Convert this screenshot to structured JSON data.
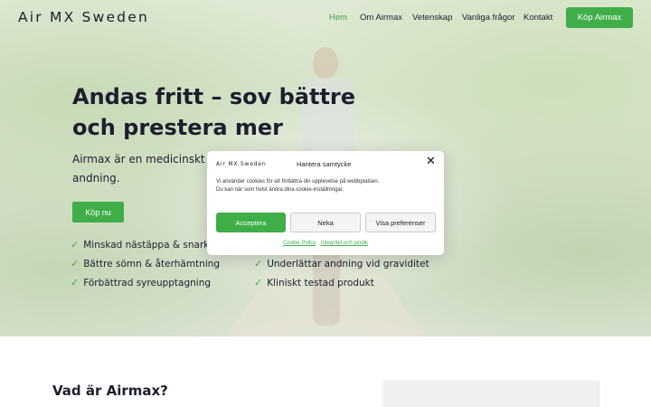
{
  "header": {
    "brand": "Air MX Sweden",
    "nav": [
      {
        "label": "Hem",
        "active": true
      },
      {
        "label": "Om Airmax",
        "active": false
      },
      {
        "label": "Vetenskap",
        "active": false
      },
      {
        "label": "Vanliga frågor",
        "active": false
      },
      {
        "label": "Kontakt",
        "active": false
      }
    ],
    "buy_label": "Köp Airmax"
  },
  "hero": {
    "title": "Andas fritt – sov bättre och prestera mer",
    "subtitle": "Airmax är en medicinskt testad produkt för bättre andning.",
    "buy_label": "Köp nu",
    "features": [
      "Minskad nästäppa & snarkning",
      "Bättre sömn & återhämtning",
      "Förbättrad syreupptagning",
      "Underlättar andning vid graviditet",
      "Kliniskt testad produkt"
    ]
  },
  "cookie_modal": {
    "brand": "Air MX Sweden",
    "title": "Hantera samtycke",
    "close_icon": "close-icon",
    "text_line1": "Vi använder cookies för att förbättra din upplevelse på webbplatsen.",
    "text_line2": "Du kan när som helst ändra dina cookie-inställningar.",
    "accept_label": "Acceptera",
    "deny_label": "Neka",
    "prefs_label": "Visa preferenser",
    "link_cookie_policy": "Cookie Policy",
    "link_privacy": "Integritet och juridik"
  },
  "section": {
    "title": "Vad är Airmax?"
  },
  "colors": {
    "accent": "#3fae49",
    "text": "#1c1f2e"
  }
}
